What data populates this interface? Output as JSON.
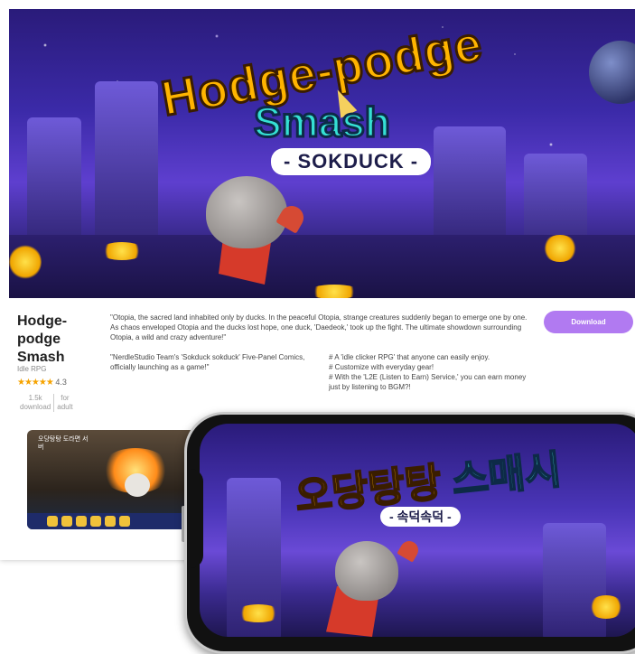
{
  "banner": {
    "title_line1": "Hodge-podge",
    "title_line2": "Smash",
    "title_line3": "- SOKDUCK -"
  },
  "game": {
    "title": "Hodge-podge Smash",
    "genre": "Idle RPG",
    "rating_stars": "★★★★★",
    "rating_value": "4.3",
    "downloads_value": "1.5k",
    "downloads_label": "download",
    "age_value": "for",
    "age_label": "adult"
  },
  "description": "\"Otopia, the sacred land inhabited only by ducks. In the peaceful Otopia, strange creatures suddenly began to emerge one by one. As chaos enveloped Otopia and the ducks lost hope, one duck, 'Daedeok,' took up the fight. The ultimate showdown surrounding Otopia, a wild and crazy adventure!\"",
  "comics_note": "\"NerdleStudio Team's 'Sokduck sokduck' Five-Panel Comics, officially launching as a game!\"",
  "features": [
    "# A 'idle clicker RPG' that anyone can easily enjoy.",
    "# Customize with everyday gear!",
    "# With the 'L2E (Listen to Earn) Service,' you can earn money just by listening to BGM?!"
  ],
  "download_label": "Download",
  "thumbnail": {
    "label": "오당탕탕 도라면 서버"
  },
  "phone": {
    "title_ko_part1": "오당탕탕",
    "title_ko_part2": "스매시",
    "subtitle_ko": "- 속덕속덕 -"
  },
  "colors": {
    "accent": "#b17af1",
    "star": "#f6a300",
    "title_gold": "#ffb400",
    "title_cyan": "#35e0d4"
  }
}
